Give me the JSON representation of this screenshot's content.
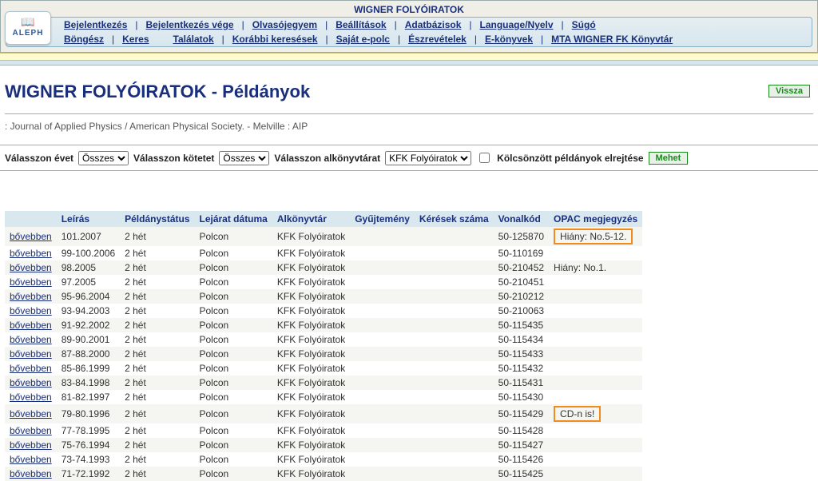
{
  "app_title": "WIGNER FOLYÓIRATOK",
  "logo": {
    "top": "📖",
    "bottom": "ALEPH"
  },
  "nav": {
    "row1": [
      "Bejelentkezés",
      "|",
      "Bejelentkezés vége",
      "|",
      "Olvasójegyem",
      "|",
      "Beállítások",
      "|",
      "Adatbázisok",
      "|",
      "Language/Nyelv",
      "|",
      "Súgó"
    ],
    "row2": [
      "Böngész",
      " | ",
      "Keres",
      "",
      "Találatok",
      "|",
      "Korábbi keresések",
      "|",
      "Saját e-polc",
      "|",
      "Észrevételek",
      "|",
      "E-könyvek",
      "|",
      "MTA WIGNER FK Könyvtár"
    ]
  },
  "page_title": "WIGNER FOLYÓIRATOK - Példányok",
  "back_button": "Vissza",
  "record_line": ": Journal of Applied Physics / American Physical Society. - Melville : AIP",
  "filters": {
    "year_label": "Válasszon évet",
    "year_value": "Összes",
    "volume_label": "Válasszon kötetet",
    "volume_value": "Összes",
    "sublib_label": "Válasszon alkönyvtárat",
    "sublib_value": "KFK Folyóiratok",
    "hide_loaned_label": "Kölcsönzött példányok elrejtése",
    "go_button": "Mehet"
  },
  "columns": [
    "",
    "Leírás",
    "Példánystátus",
    "Lejárat dátuma",
    "Alkönyvtár",
    "Gyűjtemény",
    "Kérések száma",
    "Vonalkód",
    "OPAC megjegyzés"
  ],
  "more_label": "bővebben",
  "rows": [
    {
      "desc": "101.2007",
      "status": "2 hét",
      "loc": "Polcon",
      "sub": "KFK Folyóiratok",
      "barcode": "50-125870",
      "note": "Hiány: No.5-12.",
      "highlight": true
    },
    {
      "desc": "99-100.2006",
      "status": "2 hét",
      "loc": "Polcon",
      "sub": "KFK Folyóiratok",
      "barcode": "50-110169",
      "note": ""
    },
    {
      "desc": "98.2005",
      "status": "2 hét",
      "loc": "Polcon",
      "sub": "KFK Folyóiratok",
      "barcode": "50-210452",
      "note": "Hiány: No.1."
    },
    {
      "desc": "97.2005",
      "status": "2 hét",
      "loc": "Polcon",
      "sub": "KFK Folyóiratok",
      "barcode": "50-210451",
      "note": ""
    },
    {
      "desc": "95-96.2004",
      "status": "2 hét",
      "loc": "Polcon",
      "sub": "KFK Folyóiratok",
      "barcode": "50-210212",
      "note": ""
    },
    {
      "desc": "93-94.2003",
      "status": "2 hét",
      "loc": "Polcon",
      "sub": "KFK Folyóiratok",
      "barcode": "50-210063",
      "note": ""
    },
    {
      "desc": "91-92.2002",
      "status": "2 hét",
      "loc": "Polcon",
      "sub": "KFK Folyóiratok",
      "barcode": "50-115435",
      "note": ""
    },
    {
      "desc": "89-90.2001",
      "status": "2 hét",
      "loc": "Polcon",
      "sub": "KFK Folyóiratok",
      "barcode": "50-115434",
      "note": ""
    },
    {
      "desc": "87-88.2000",
      "status": "2 hét",
      "loc": "Polcon",
      "sub": "KFK Folyóiratok",
      "barcode": "50-115433",
      "note": ""
    },
    {
      "desc": "85-86.1999",
      "status": "2 hét",
      "loc": "Polcon",
      "sub": "KFK Folyóiratok",
      "barcode": "50-115432",
      "note": ""
    },
    {
      "desc": "83-84.1998",
      "status": "2 hét",
      "loc": "Polcon",
      "sub": "KFK Folyóiratok",
      "barcode": "50-115431",
      "note": ""
    },
    {
      "desc": "81-82.1997",
      "status": "2 hét",
      "loc": "Polcon",
      "sub": "KFK Folyóiratok",
      "barcode": "50-115430",
      "note": ""
    },
    {
      "desc": "79-80.1996",
      "status": "2 hét",
      "loc": "Polcon",
      "sub": "KFK Folyóiratok",
      "barcode": "50-115429",
      "note": "CD-n is!",
      "highlight": true
    },
    {
      "desc": "77-78.1995",
      "status": "2 hét",
      "loc": "Polcon",
      "sub": "KFK Folyóiratok",
      "barcode": "50-115428",
      "note": ""
    },
    {
      "desc": "75-76.1994",
      "status": "2 hét",
      "loc": "Polcon",
      "sub": "KFK Folyóiratok",
      "barcode": "50-115427",
      "note": ""
    },
    {
      "desc": "73-74.1993",
      "status": "2 hét",
      "loc": "Polcon",
      "sub": "KFK Folyóiratok",
      "barcode": "50-115426",
      "note": ""
    },
    {
      "desc": "71-72.1992",
      "status": "2 hét",
      "loc": "Polcon",
      "sub": "KFK Folyóiratok",
      "barcode": "50-115425",
      "note": ""
    }
  ]
}
